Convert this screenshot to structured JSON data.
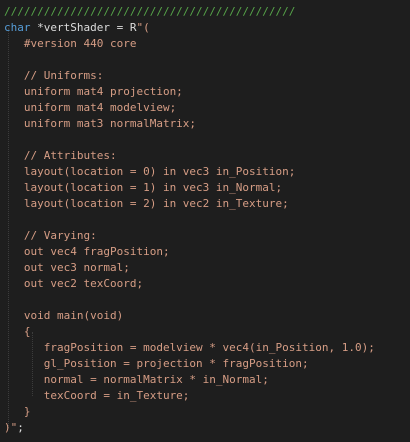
{
  "colors": {
    "background": "#1e1e1e",
    "comment": "#57a64a",
    "keyword": "#569cd6",
    "string": "#d69d85",
    "plain": "#dcdcdc"
  },
  "code": {
    "lines": [
      [
        {
          "t": "comment",
          "s": "////////////////////////////////////////////"
        }
      ],
      [
        {
          "t": "keyword",
          "s": "char"
        },
        {
          "t": "plain",
          "s": " *vertShader = R"
        },
        {
          "t": "string",
          "s": "\"("
        }
      ],
      [
        {
          "t": "string",
          "s": "   #version 440 core"
        }
      ],
      [
        {
          "t": "string",
          "s": ""
        }
      ],
      [
        {
          "t": "string",
          "s": "   // Uniforms:"
        }
      ],
      [
        {
          "t": "string",
          "s": "   uniform mat4 projection;"
        }
      ],
      [
        {
          "t": "string",
          "s": "   uniform mat4 modelview;"
        }
      ],
      [
        {
          "t": "string",
          "s": "   uniform mat3 normalMatrix;"
        }
      ],
      [
        {
          "t": "string",
          "s": ""
        }
      ],
      [
        {
          "t": "string",
          "s": "   // Attributes:"
        }
      ],
      [
        {
          "t": "string",
          "s": "   layout(location = 0) in vec3 in_Position;"
        }
      ],
      [
        {
          "t": "string",
          "s": "   layout(location = 1) in vec3 in_Normal;"
        }
      ],
      [
        {
          "t": "string",
          "s": "   layout(location = 2) in vec2 in_Texture;"
        }
      ],
      [
        {
          "t": "string",
          "s": ""
        }
      ],
      [
        {
          "t": "string",
          "s": "   // Varying:"
        }
      ],
      [
        {
          "t": "string",
          "s": "   out vec4 fragPosition;"
        }
      ],
      [
        {
          "t": "string",
          "s": "   out vec3 normal;"
        }
      ],
      [
        {
          "t": "string",
          "s": "   out vec2 texCoord;"
        }
      ],
      [
        {
          "t": "string",
          "s": ""
        }
      ],
      [
        {
          "t": "string",
          "s": "   void main(void)"
        }
      ],
      [
        {
          "t": "string",
          "s": "   {"
        }
      ],
      [
        {
          "t": "string",
          "s": "      fragPosition = modelview * vec4(in_Position, 1.0);"
        }
      ],
      [
        {
          "t": "string",
          "s": "      gl_Position = projection * fragPosition;"
        }
      ],
      [
        {
          "t": "string",
          "s": "      normal = normalMatrix * in_Normal;"
        }
      ],
      [
        {
          "t": "string",
          "s": "      texCoord = in_Texture;"
        }
      ],
      [
        {
          "t": "string",
          "s": "   }"
        }
      ],
      [
        {
          "t": "string",
          "s": ")\""
        },
        {
          "t": "plain",
          "s": ";"
        }
      ]
    ]
  }
}
